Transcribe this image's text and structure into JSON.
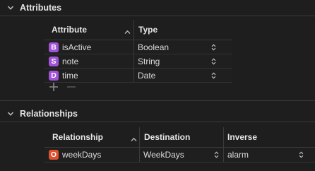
{
  "attributes_section": {
    "title": "Attributes",
    "columns": {
      "attribute": "Attribute",
      "type": "Type"
    },
    "rows": [
      {
        "badge": "B",
        "badge_color": "#a152d8",
        "name": "isActive",
        "type": "Boolean"
      },
      {
        "badge": "S",
        "badge_color": "#a152d8",
        "name": "note",
        "type": "String"
      },
      {
        "badge": "D",
        "badge_color": "#a152d8",
        "name": "time",
        "type": "Date"
      }
    ],
    "add_icon": "plus-icon",
    "remove_icon": "minus-icon"
  },
  "relationships_section": {
    "title": "Relationships",
    "columns": {
      "relationship": "Relationship",
      "destination": "Destination",
      "inverse": "Inverse"
    },
    "rows": [
      {
        "badge": "O",
        "badge_color": "#e0502d",
        "name": "weekDays",
        "destination": "WeekDays",
        "inverse": "alarm"
      }
    ]
  },
  "colors": {
    "background": "#1e1e1e",
    "separator": "#3a3a3a",
    "attribute_badge": "#a152d8",
    "relationship_badge": "#e0502d"
  }
}
